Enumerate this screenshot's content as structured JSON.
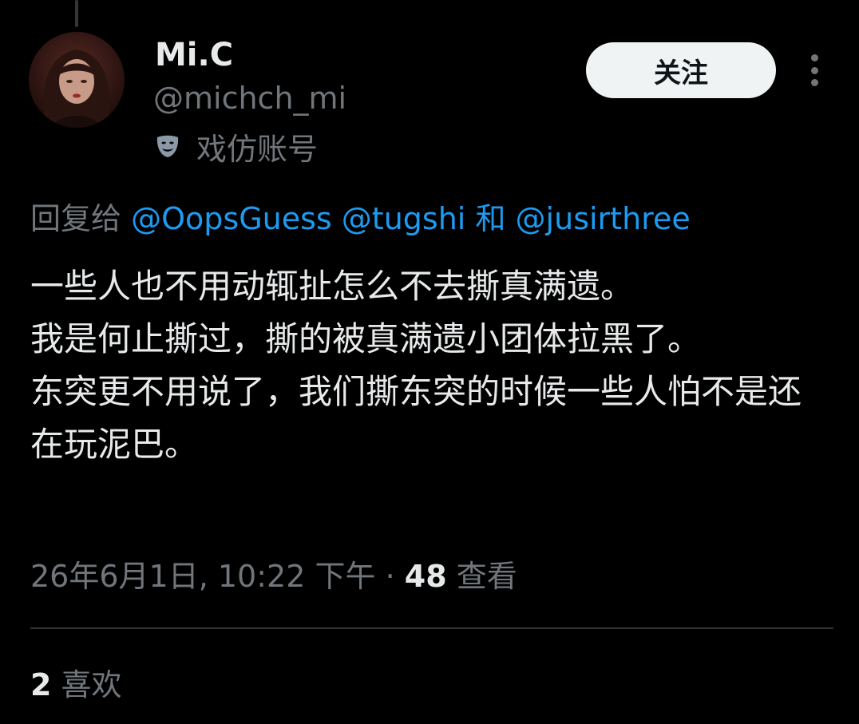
{
  "author": {
    "display_name": "Mi.C",
    "handle": "@michch_mi",
    "account_label": "戏仿账号",
    "account_label_icon": "parody-mask-icon"
  },
  "follow_button": {
    "label": "关注"
  },
  "more_menu_icon": "more-vertical-icon",
  "reply": {
    "prefix": "回复给",
    "mention_1": "@OopsGuess",
    "mention_2": "@tugshi",
    "conjunction": "和",
    "mention_3": "@jusirthree"
  },
  "tweet": {
    "paragraph_1": "一些人也不用动辄扯怎么不去撕真满遗。",
    "paragraph_2": "我是何止撕过，撕的被真满遗小团体拉黑了。",
    "paragraph_3": "东突更不用说了，我们撕东突的时候一些人怕不是还在玩泥巴。"
  },
  "meta": {
    "timestamp": "26年6月1日, 10:22 下午",
    "separator": "·",
    "views_count": "48",
    "views_label": "查看"
  },
  "stats": {
    "likes_count": "2",
    "likes_label": "喜欢"
  },
  "colors": {
    "background": "#000000",
    "primary_text": "#e7e9ea",
    "secondary_text": "#71767b",
    "link": "#1d9bf0",
    "follow_button_bg": "#eff3f4",
    "divider": "#2f3336"
  }
}
